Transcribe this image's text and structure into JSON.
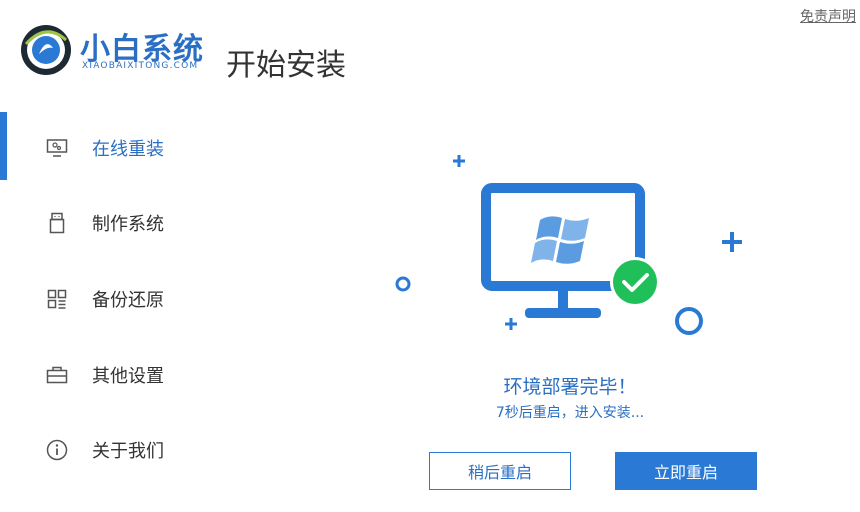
{
  "header": {
    "brand_name": "小白系统",
    "brand_domain": "XIAOBAIXITONG.COM",
    "page_title": "开始安装",
    "disclaimer_link": "免责声明"
  },
  "sidebar": {
    "items": [
      {
        "label": "在线重装",
        "icon": "monitor-icon",
        "active": true
      },
      {
        "label": "制作系统",
        "icon": "usb-drive-icon",
        "active": false
      },
      {
        "label": "备份还原",
        "icon": "grid-icon",
        "active": false
      },
      {
        "label": "其他设置",
        "icon": "briefcase-icon",
        "active": false
      },
      {
        "label": "关于我们",
        "icon": "info-icon",
        "active": false
      }
    ]
  },
  "status": {
    "title": "环境部署完毕！",
    "subtitle": "7秒后重启，进入安装...",
    "illustration": "monitor-with-windows-logo-and-check-icon"
  },
  "buttons": {
    "restart_later": "稍后重启",
    "restart_now": "立即重启"
  },
  "colors": {
    "accent": "#2a7ad5",
    "brand_text": "#2a6fc4",
    "success": "#1fbf5a",
    "text": "#333333"
  }
}
